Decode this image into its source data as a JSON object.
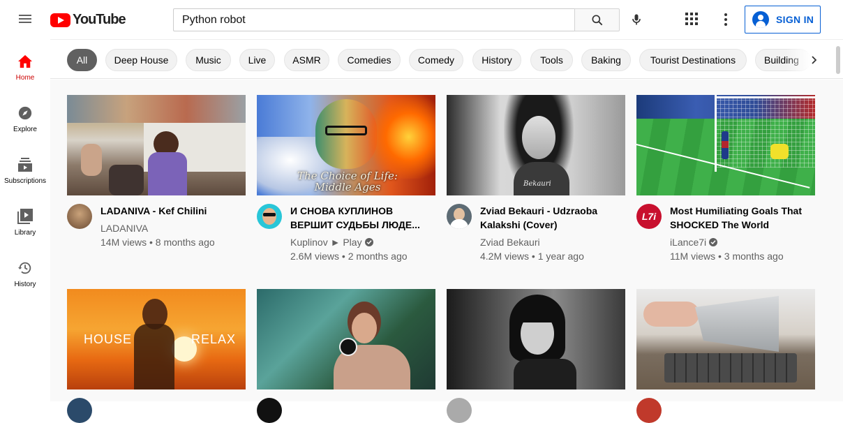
{
  "header": {
    "logo_text": "YouTube",
    "search_value": "Python robot",
    "sign_in_label": "SIGN IN"
  },
  "sidebar": {
    "items": [
      {
        "label": "Home"
      },
      {
        "label": "Explore"
      },
      {
        "label": "Subscriptions"
      },
      {
        "label": "Library"
      },
      {
        "label": "History"
      }
    ]
  },
  "chips": [
    "All",
    "Deep House",
    "Music",
    "Live",
    "ASMR",
    "Comedies",
    "Comedy",
    "History",
    "Tools",
    "Baking",
    "Tourist Destinations",
    "Building"
  ],
  "videos": [
    {
      "title": "LADANIVA - Kef Chilini",
      "channel": "LADANIVA",
      "verified": false,
      "stats": "14M views • 8 months ago"
    },
    {
      "title": "И СНОВА КУПЛИНОВ ВЕРШИТ СУДЬБЫ ЛЮДЕ...",
      "channel": "Kuplinov ► Play",
      "verified": true,
      "stats": "2.6M views • 2 months ago",
      "thumb_text": "The Choice of Life: Middle Ages"
    },
    {
      "title": "Zviad Bekauri - Udzraoba Kalakshi (Cover)",
      "channel": "Zviad Bekauri",
      "verified": false,
      "stats": "4.2M views • 1 year ago",
      "thumb_text": "Bekauri"
    },
    {
      "title": "Most Humiliating Goals That SHOCKED The World",
      "channel": "iLance7i",
      "verified": true,
      "stats": "11M views • 3 months ago",
      "avatar_text": "L7i"
    },
    {
      "thumb_text_left": "HOUSE",
      "thumb_text_right": "RELAX"
    },
    {},
    {},
    {}
  ],
  "colors": {
    "brand_red": "#ff0000",
    "sign_in_blue": "#065fd4",
    "active_chip": "#606060"
  }
}
